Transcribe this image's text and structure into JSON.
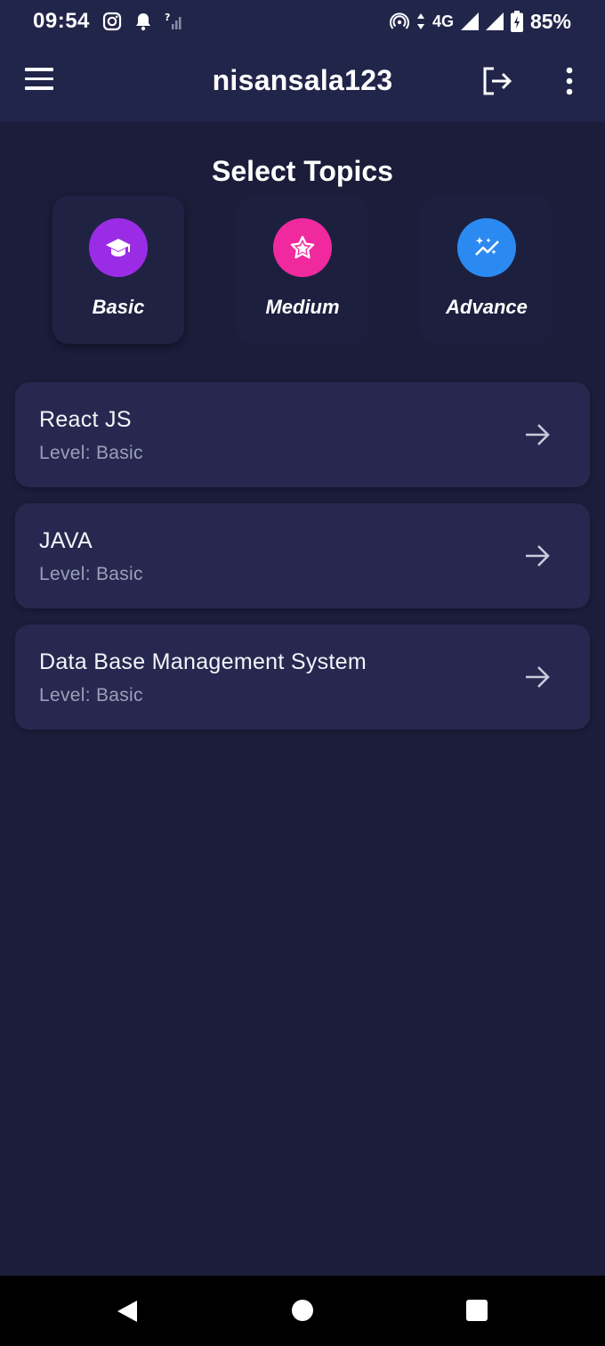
{
  "status_bar": {
    "time": "09:54",
    "network": "4G",
    "battery": "85%",
    "icons": [
      "instagram-icon",
      "notification-bell-icon",
      "no-signal-icon",
      "hotspot-icon",
      "data-arrows-icon",
      "signal-icon",
      "battery-charging-icon"
    ]
  },
  "app_bar": {
    "title": "nisansala123",
    "icons": [
      "menu-icon",
      "logout-icon",
      "more-vert-icon"
    ]
  },
  "section": {
    "title": "Select Topics"
  },
  "levels": [
    {
      "label": "Basic",
      "icon": "graduation-cap-icon",
      "color": "#9b2ce6",
      "selected": true
    },
    {
      "label": "Medium",
      "icon": "star-icon",
      "color": "#f02a9e",
      "selected": false
    },
    {
      "label": "Advance",
      "icon": "sparkle-trend-icon",
      "color": "#2b8af2",
      "selected": false
    }
  ],
  "topics": [
    {
      "name": "React JS",
      "level": "Level: Basic"
    },
    {
      "name": "JAVA",
      "level": "Level: Basic"
    },
    {
      "name": "Data Base Management System",
      "level": "Level: Basic"
    }
  ],
  "nav_bar": {
    "icons": [
      "back-icon",
      "home-icon",
      "recents-icon"
    ]
  },
  "colors": {
    "background": "#1b1d3a",
    "header": "#22254a",
    "card": "#262850",
    "subtext": "#9c9fb8"
  }
}
